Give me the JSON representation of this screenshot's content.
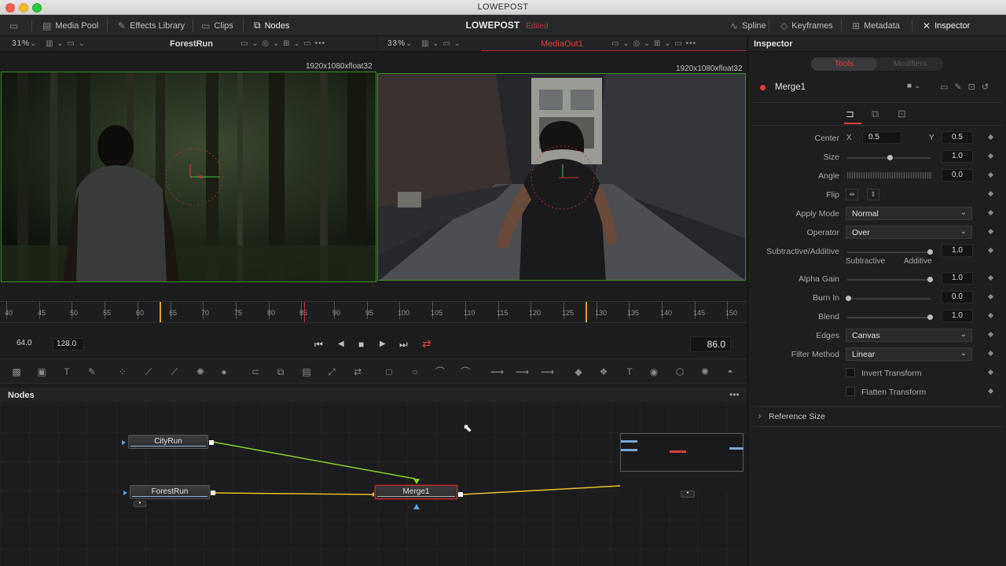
{
  "window": {
    "title": "LOWEPOST"
  },
  "toolbar": {
    "media_pool": "Media Pool",
    "effects_library": "Effects Library",
    "clips": "Clips",
    "nodes": "Nodes",
    "project_name": "LOWEPOST",
    "edited": "Edited",
    "spline": "Spline",
    "keyframes": "Keyframes",
    "metadata": "Metadata",
    "inspector": "Inspector"
  },
  "viewer_left": {
    "zoom": "31%",
    "title": "ForestRun",
    "resolution": "1920x1080xfloat32"
  },
  "viewer_right": {
    "zoom": "33%",
    "title": "MediaOut1",
    "resolution": "1920x1080xfloat32"
  },
  "timeline": {
    "ruler_labels": [
      "40",
      "45",
      "50",
      "55",
      "60",
      "65",
      "70",
      "75",
      "80",
      "85",
      "90",
      "95",
      "100",
      "105",
      "110",
      "115",
      "120",
      "125",
      "130",
      "135",
      "140",
      "145",
      "150"
    ],
    "render_start": "64.0",
    "render_end": "128.0",
    "current_time": "86.0"
  },
  "nodes_panel": {
    "title": "Nodes",
    "nodes": {
      "city_run": "CityRun",
      "forest_run": "ForestRun",
      "merge1": "Merge1"
    }
  },
  "inspector": {
    "title": "Inspector",
    "tab_tools": "Tools",
    "tab_modifiers": "Modifiers",
    "node_name": "Merge1",
    "center_label": "Center",
    "center_x_label": "X",
    "center_x": "0.5",
    "center_y_label": "Y",
    "center_y": "0.5",
    "size_label": "Size",
    "size": "1.0",
    "angle_label": "Angle",
    "angle": "0.0",
    "flip_label": "Flip",
    "apply_mode_label": "Apply Mode",
    "apply_mode": "Normal",
    "operator_label": "Operator",
    "operator": "Over",
    "subadd_label": "Subtractive/Additive",
    "subadd": "1.0",
    "subtractive": "Subtractive",
    "additive": "Additive",
    "alpha_gain_label": "Alpha Gain",
    "alpha_gain": "1.0",
    "burn_in_label": "Burn In",
    "burn_in": "0.0",
    "blend_label": "Blend",
    "blend": "1.0",
    "edges_label": "Edges",
    "edges": "Canvas",
    "filter_label": "Filter Method",
    "filter": "Linear",
    "invert_transform": "Invert Transform",
    "flatten_transform": "Flatten Transform",
    "reference_size": "Reference Size"
  },
  "colors": {
    "accent_red": "#e0403a",
    "link_green": "#8bd02a",
    "link_yellow": "#e6c02a",
    "viewer_border": "#3a8a2a"
  }
}
